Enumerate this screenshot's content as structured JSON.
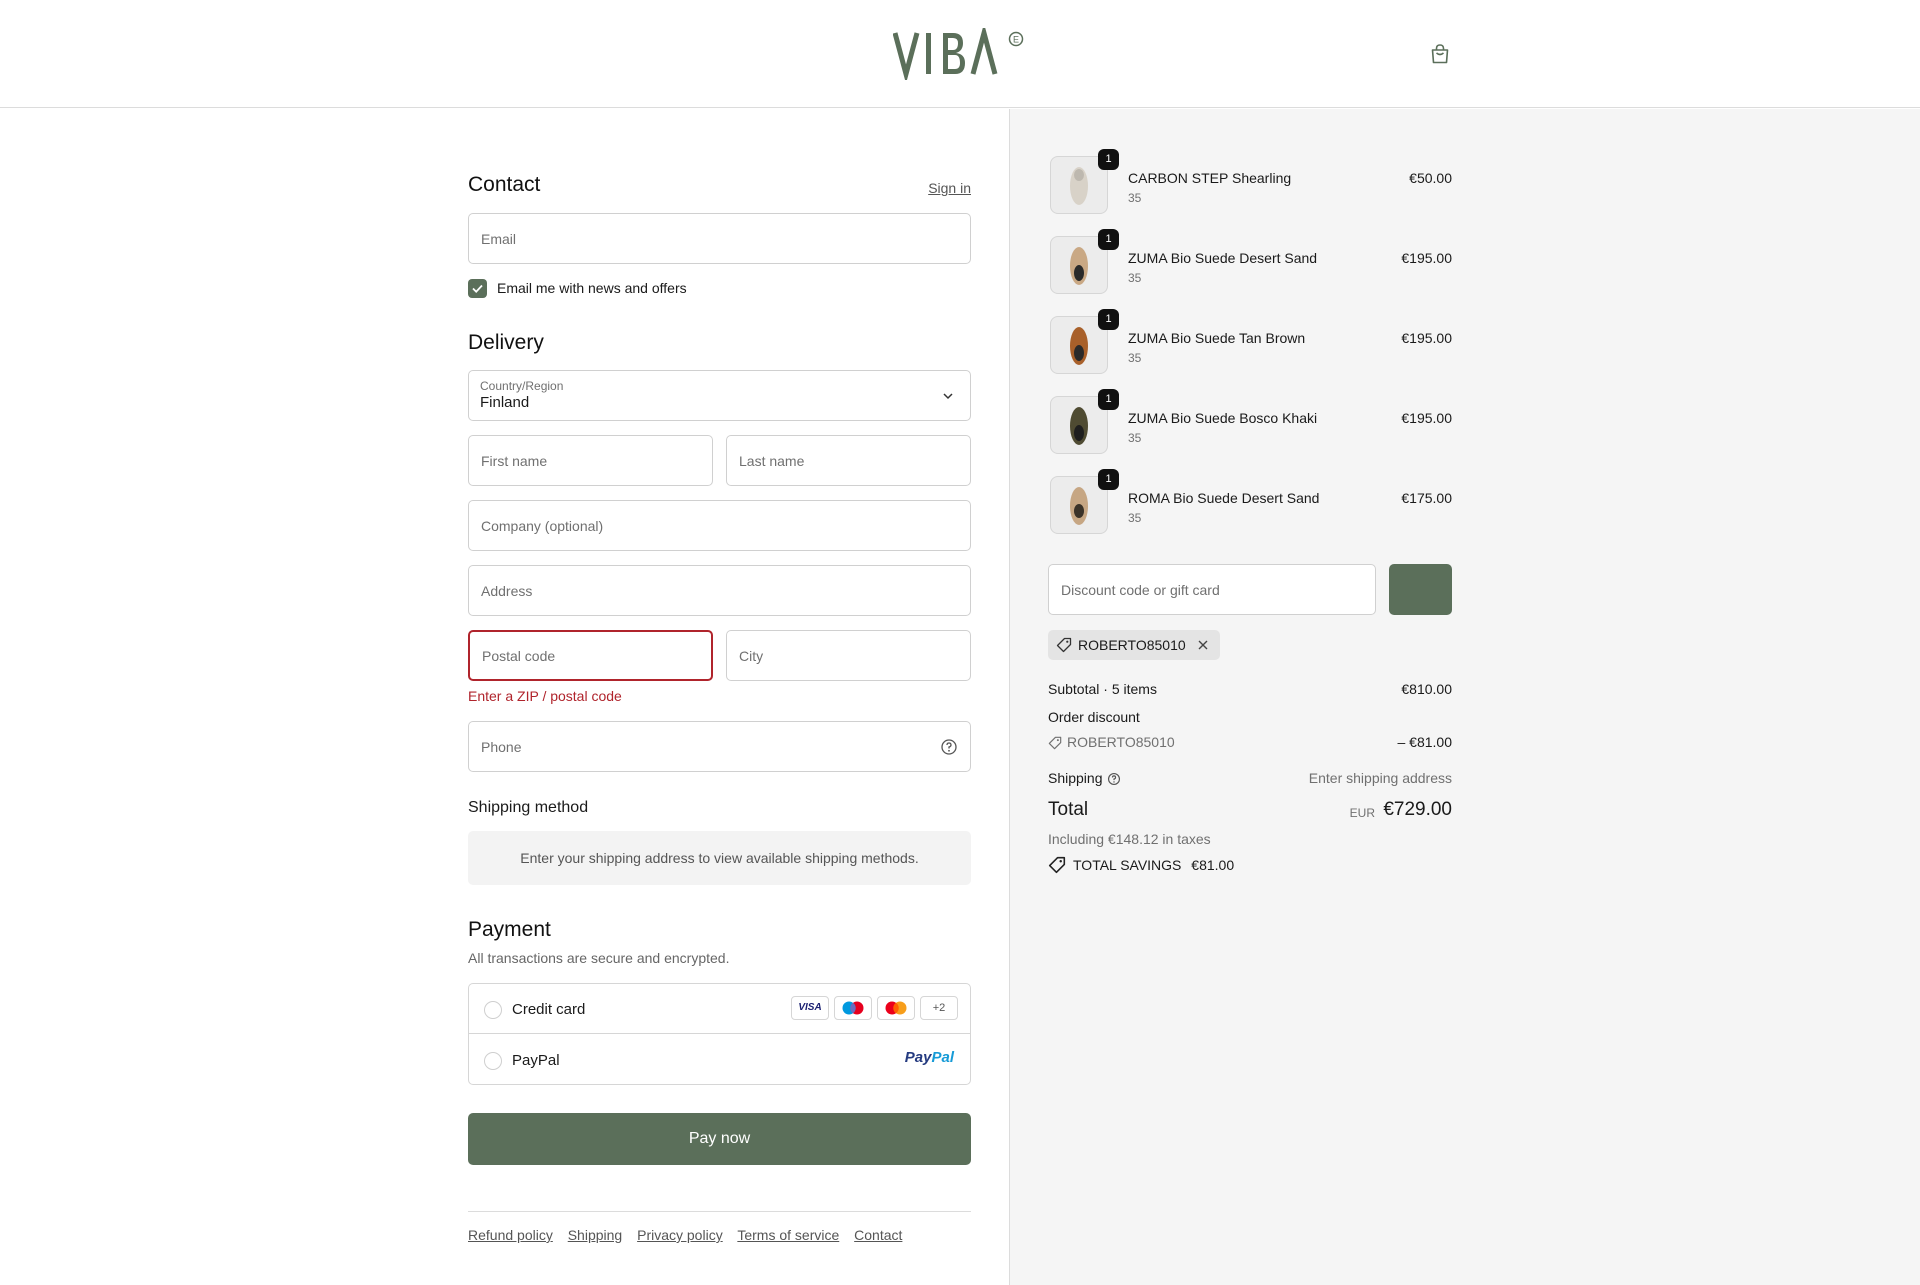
{
  "header": {
    "logo_text": "VIBA",
    "cart_icon": "shopping-bag-icon"
  },
  "contact": {
    "title": "Contact",
    "sign_in": "Sign in",
    "email_placeholder": "Email",
    "newsletter_label": "Email me with news and offers",
    "newsletter_checked": true
  },
  "delivery": {
    "title": "Delivery",
    "country_label": "Country/Region",
    "country_value": "Finland",
    "first_name_placeholder": "First name",
    "last_name_placeholder": "Last name",
    "company_placeholder": "Company (optional)",
    "address_placeholder": "Address",
    "postal_placeholder": "Postal code",
    "city_placeholder": "City",
    "postal_error": "Enter a ZIP / postal code",
    "phone_placeholder": "Phone"
  },
  "shipping_method": {
    "title": "Shipping method",
    "info": "Enter your shipping address to view available shipping methods."
  },
  "payment": {
    "title": "Payment",
    "subtitle": "All transactions are secure and encrypted.",
    "options": [
      {
        "label": "Credit card"
      },
      {
        "label": "PayPal"
      }
    ],
    "card_brands": [
      "VISA",
      "Maestro",
      "Mastercard"
    ],
    "more_cards": "+2",
    "paypal_logo_text": "PayPal",
    "pay_button": "Pay now"
  },
  "footer_links": [
    "Refund policy",
    "Shipping",
    "Privacy policy",
    "Terms of service",
    "Contact"
  ],
  "order": {
    "items": [
      {
        "name": "CARBON STEP Shearling",
        "variant": "35",
        "price": "€50.00",
        "qty": "1",
        "color": "#d8d2c8"
      },
      {
        "name": "ZUMA Bio Suede Desert Sand",
        "variant": "35",
        "price": "€195.00",
        "qty": "1",
        "color": "#c9a884"
      },
      {
        "name": "ZUMA Bio Suede Tan Brown",
        "variant": "35",
        "price": "€195.00",
        "qty": "1",
        "color": "#a8602a"
      },
      {
        "name": "ZUMA Bio Suede Bosco Khaki",
        "variant": "35",
        "price": "€195.00",
        "qty": "1",
        "color": "#4f4b32"
      },
      {
        "name": "ROMA Bio Suede Desert Sand",
        "variant": "35",
        "price": "€175.00",
        "qty": "1",
        "color": "#c6a683"
      }
    ],
    "discount_placeholder": "Discount code or gift card",
    "applied_code": "ROBERTO85010",
    "subtotal_label": "Subtotal · 5 items",
    "subtotal_value": "€810.00",
    "order_discount_label": "Order discount",
    "discount_code": "ROBERTO85010",
    "discount_value": "– €81.00",
    "shipping_label": "Shipping",
    "shipping_value": "Enter shipping address",
    "total_label": "Total",
    "total_currency": "EUR",
    "total_value": "€729.00",
    "taxes_note": "Including €148.12 in taxes",
    "savings_label": "TOTAL SAVINGS",
    "savings_value": "€81.00"
  },
  "colors": {
    "accent": "#5b6f5a",
    "error": "#b0242c",
    "summary_bg": "#f5f5f5"
  }
}
